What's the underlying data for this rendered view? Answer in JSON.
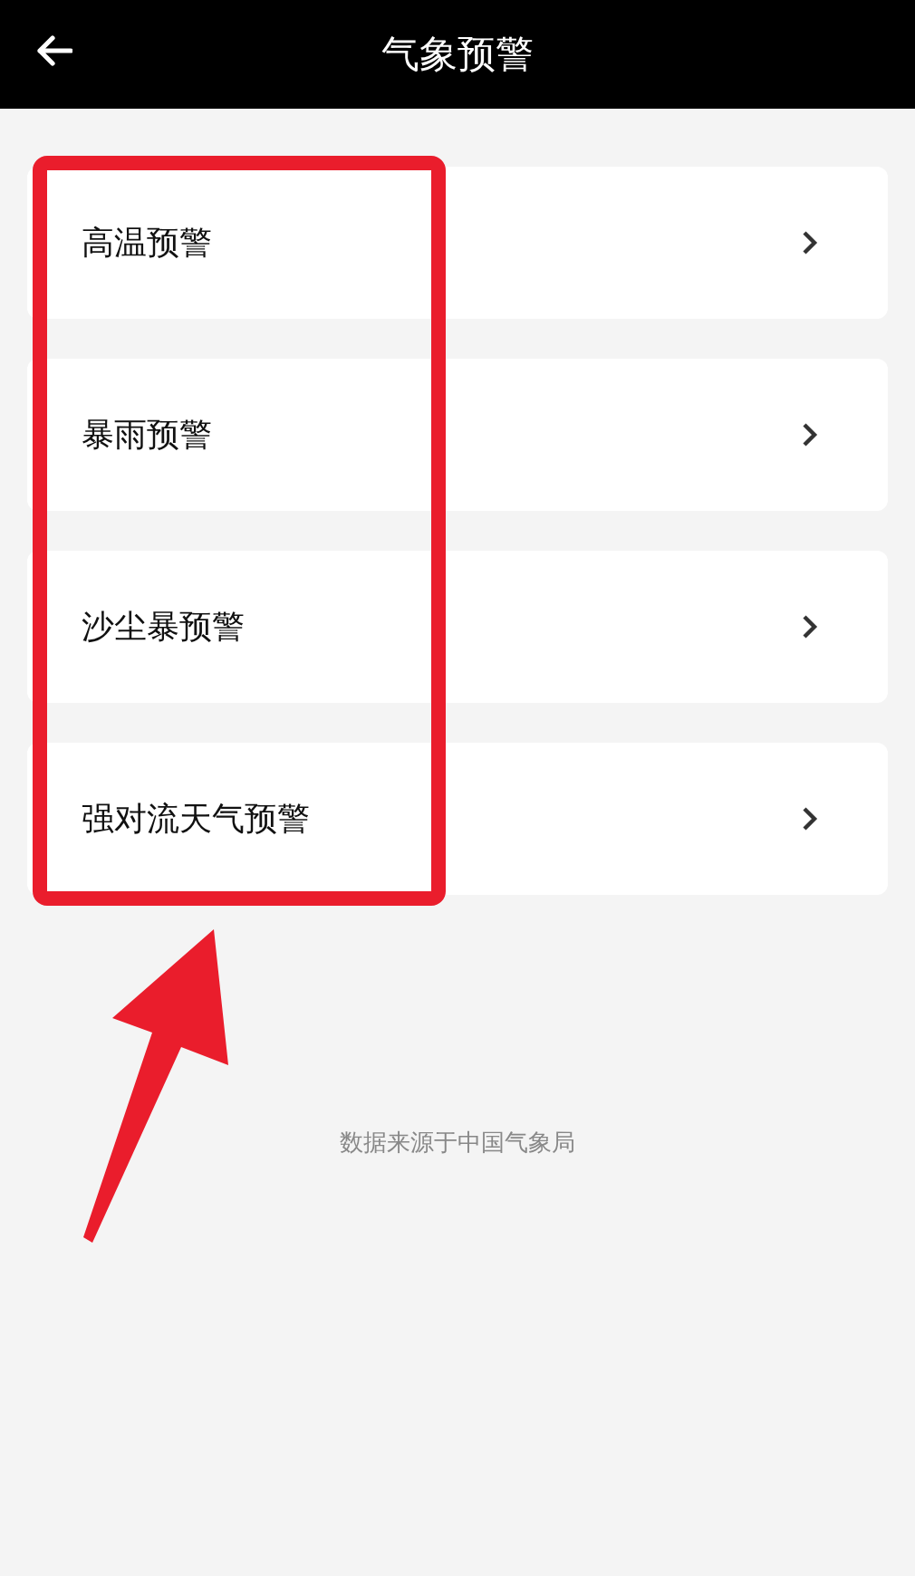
{
  "header": {
    "title": "气象预警"
  },
  "items": [
    {
      "label": "高温预警"
    },
    {
      "label": "暴雨预警"
    },
    {
      "label": "沙尘暴预警"
    },
    {
      "label": "强对流天气预警"
    }
  ],
  "footer": "数据来源于中国气象局"
}
